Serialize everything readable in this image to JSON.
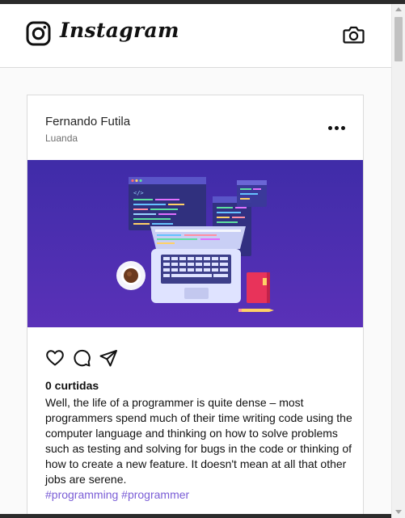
{
  "app": {
    "name": "Instagram"
  },
  "post": {
    "author": "Fernando Futila",
    "location": "Luanda",
    "likes": "0 curtidas",
    "caption": "Well, the life of a programmer is quite dense – most programmers spend much of their time writing code using the computer language and thinking on how to solve problems such as testing and solving for bugs in the code or thinking of how to create a new feature. It doesn't mean at all that other jobs are serene.",
    "hashtags": [
      "#programming",
      "#programmer"
    ],
    "code_snippet": "</>"
  },
  "icons": {
    "logo": "instagram-logo-icon",
    "camera": "camera-icon",
    "more": "more-options-icon",
    "like": "heart-icon",
    "comment": "comment-icon",
    "share": "send-icon"
  },
  "colors": {
    "image_background": "#4b2bb0",
    "hashtag": "#7a5dd6",
    "notebook": "#e8335a"
  }
}
